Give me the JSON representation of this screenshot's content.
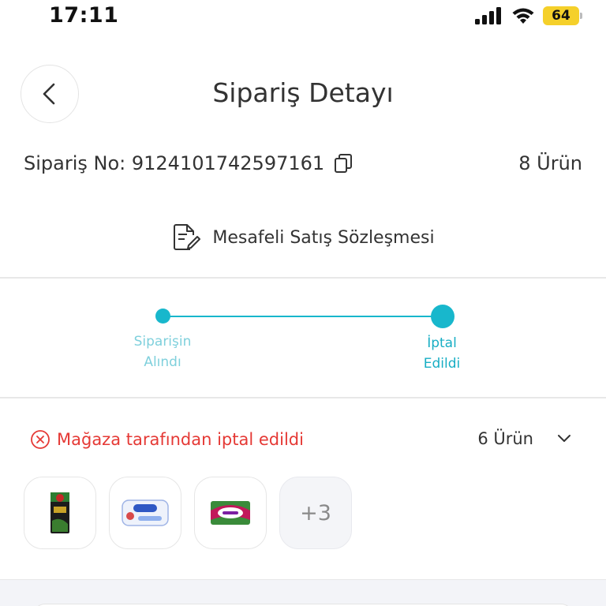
{
  "status_bar": {
    "time": "17:11",
    "battery": "64"
  },
  "header": {
    "title": "Sipariş Detayı"
  },
  "order": {
    "number_label": "Sipariş No: 9124101742597161",
    "item_count": "8 Ürün"
  },
  "contract": {
    "label": "Mesafeli Satış Sözleşmesi"
  },
  "progress": {
    "steps": [
      {
        "label_line1": "Siparişin",
        "label_line2": "Alındı"
      },
      {
        "label_line1": "İptal",
        "label_line2": "Edildi"
      }
    ]
  },
  "shipment": {
    "status": "Mağaza tarafından iptal edildi",
    "count": "6 Ürün",
    "more_label": "+3"
  },
  "colors": {
    "accent": "#18b7cc",
    "error": "#e53935",
    "battery": "#f5d02a"
  }
}
